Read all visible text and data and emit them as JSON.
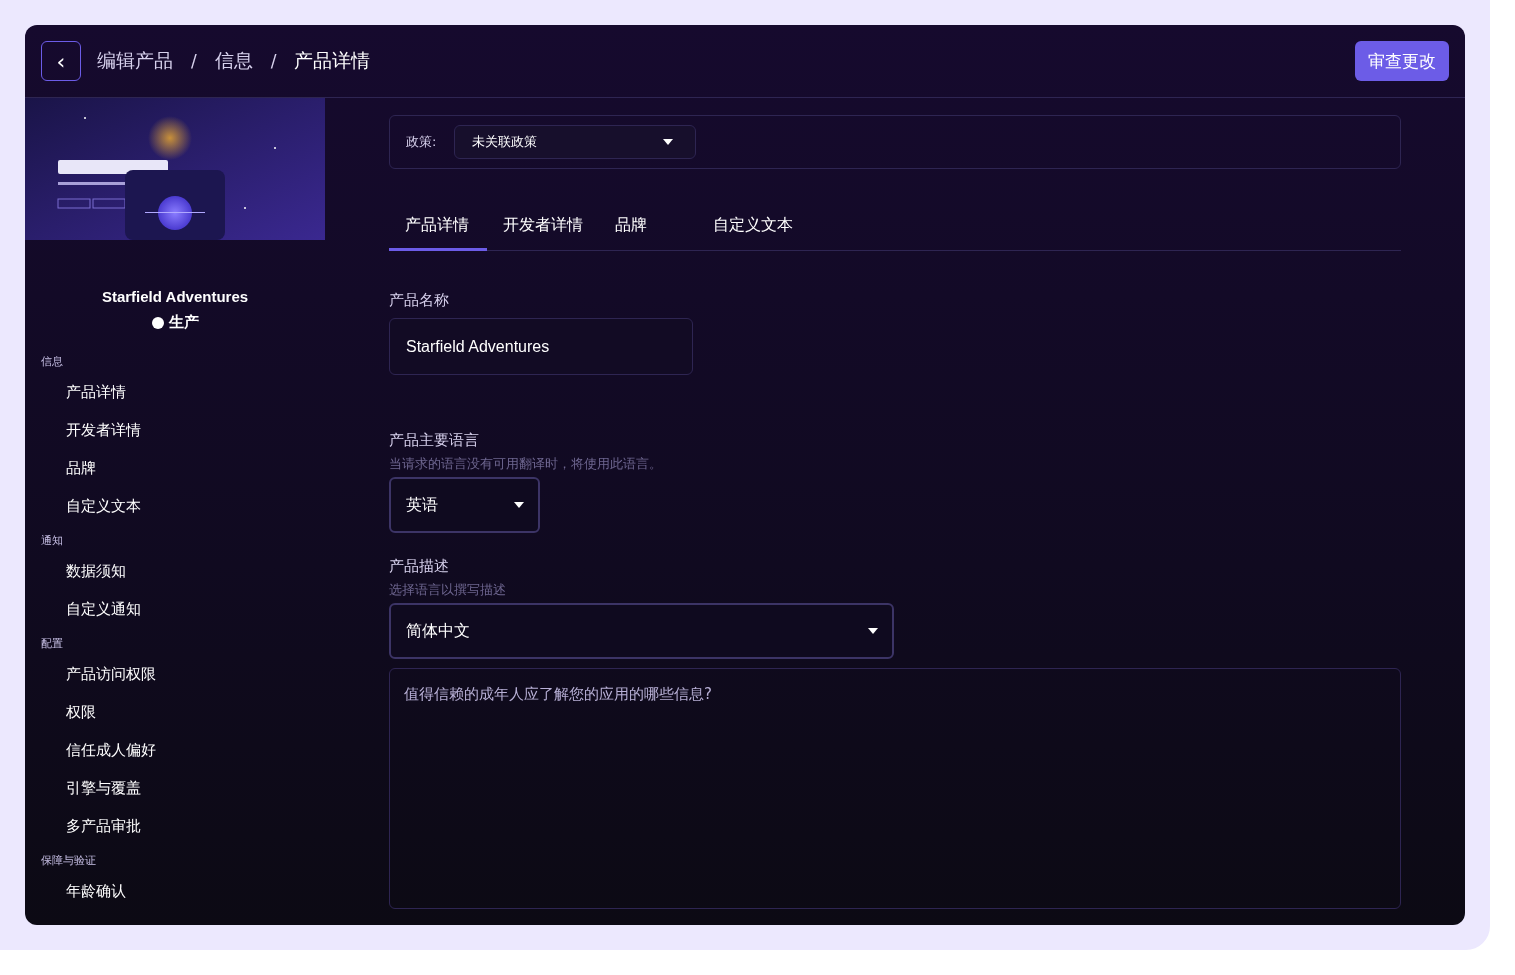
{
  "header": {
    "back_label": "‹",
    "breadcrumb": [
      "编辑产品",
      "信息",
      "产品详情"
    ],
    "separator": "/",
    "action": "审查更改"
  },
  "product": {
    "name": "Starfield Adventures",
    "status": "生产"
  },
  "sidebar": {
    "sections": [
      {
        "title": "信息",
        "items": [
          {
            "label": "产品详情",
            "selected": false
          },
          {
            "label": "开发者详情",
            "selected": false
          },
          {
            "label": "品牌",
            "selected": false
          },
          {
            "label": "自定义文本",
            "selected": false
          }
        ]
      },
      {
        "title": "通知",
        "items": [
          {
            "label": "数据须知",
            "selected": false
          },
          {
            "label": "自定义通知",
            "selected": false
          }
        ]
      },
      {
        "title": "配置",
        "items": [
          {
            "label": "产品访问权限",
            "selected": false
          },
          {
            "label": "权限",
            "selected": false
          },
          {
            "label": "信任成人偏好",
            "selected": false
          },
          {
            "label": "引擎与覆盖",
            "selected": false
          },
          {
            "label": "多产品审批",
            "selected": false
          }
        ]
      },
      {
        "title": "保障与验证",
        "items": [
          {
            "label": "年龄确认",
            "selected": false
          }
        ]
      }
    ]
  },
  "policy": {
    "label": "政策:",
    "value": "未关联政策"
  },
  "tabs": [
    {
      "label": "产品详情",
      "selected": true
    },
    {
      "label": "开发者详情",
      "selected": false
    },
    {
      "label": "品牌",
      "selected": false
    },
    {
      "label": "自定义文本",
      "selected": false
    }
  ],
  "form": {
    "name_label": "产品名称",
    "name_value": "Starfield Adventures",
    "language_label": "产品主要语言",
    "language_hint": "当请求的语言没有可用翻译时，将使用此语言。",
    "language_value": "英语",
    "description_label": "产品描述",
    "description_hint": "选择语言以撰写描述",
    "description_language": "简体中文",
    "description_placeholder": "值得信赖的成年人应了解您的应用的哪些信息?"
  }
}
